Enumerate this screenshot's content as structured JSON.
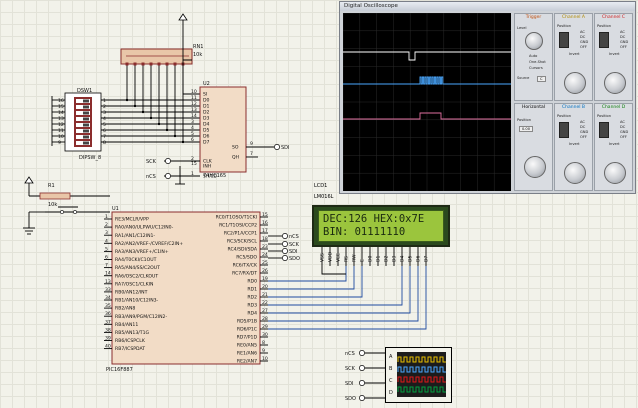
{
  "schematic": {
    "resistor_network": {
      "ref": "RN1",
      "value": "10k"
    },
    "dip_switch": {
      "ref": "DSW1",
      "part": "DIPSW_8",
      "left_pins": [
        "16",
        "15",
        "14",
        "13",
        "12",
        "11",
        "10",
        "9"
      ],
      "right_pins": [
        "1",
        "2",
        "3",
        "4",
        "5",
        "6",
        "7",
        "8"
      ]
    },
    "shift_register": {
      "ref": "U2",
      "part": "74HC165",
      "pins": [
        "SI",
        "D0",
        "D1",
        "D2",
        "D3",
        "D4",
        "D5",
        "D6",
        "D7",
        "CLK",
        "INH",
        "SH/LD"
      ],
      "out_pins": [
        "SO",
        "QH"
      ],
      "pin_numbers": [
        "10",
        "11",
        "12",
        "13",
        "14",
        "3",
        "4",
        "5",
        "6",
        "2",
        "15",
        "1",
        "9",
        "7"
      ]
    },
    "nets_u2": [
      "SCK",
      "nCS",
      "SDI"
    ],
    "resistor1": {
      "ref": "R1",
      "value": "10k"
    },
    "mcu": {
      "ref": "U1",
      "part": "PIC16F887",
      "left_pins": [
        "RE3/MCLR/VPP",
        "RA0/AN0/ULPWU/C12IN0-",
        "RA1/AN1/C12IN1-",
        "RA2/AN2/VREF-/CVREF/C2IN+",
        "RA3/AN3/VREF+/C1IN+",
        "RA4/T0CKI/C1OUT",
        "RA5/AN4/SS/C2OUT",
        "RA6/OSC2/CLKOUT",
        "RA7/OSC1/CLKIN",
        "RB0/AN12/INT",
        "RB1/AN10/C12IN3-",
        "RB2/AN8",
        "RB3/AN9/PGM/C12IN2-",
        "RB4/AN11",
        "RB5/AN13/T1G",
        "RB6/ICSPCLK",
        "RB7/ICSPDAT"
      ],
      "left_numbers": [
        "1",
        "2",
        "3",
        "4",
        "5",
        "6",
        "7",
        "14",
        "13",
        "33",
        "34",
        "35",
        "36",
        "37",
        "38",
        "39",
        "40"
      ],
      "right_pins": [
        "RC0/T1OSO/T1CKI",
        "RC1/T1OSI/CCP2",
        "RC2/P1A/CCP1",
        "RC3/SCK/SCL",
        "RC4/SDI/SDA",
        "RC5/SDO",
        "RC6/TX/CK",
        "RC7/RX/DT",
        "RD0",
        "RD1",
        "RD2",
        "RD3",
        "RD4",
        "RD5/P1B",
        "RD6/P1C",
        "RD7/P1D",
        "RE0/AN5",
        "RE1/AN6",
        "RE2/AN7"
      ],
      "right_numbers": [
        "15",
        "16",
        "17",
        "18",
        "23",
        "24",
        "25",
        "26",
        "19",
        "20",
        "21",
        "22",
        "27",
        "28",
        "29",
        "30",
        "8",
        "9",
        "10"
      ]
    },
    "mcu_nets": [
      "nCS",
      "SCK",
      "SDI",
      "SDO"
    ],
    "lcd": {
      "ref": "LCD1",
      "part": "LM016L",
      "line1": "DEC:126 HEX:0x7E",
      "line2": "BIN: 01111110",
      "pins": [
        "VSS",
        "VDD",
        "VEE",
        "RS",
        "RW",
        "E",
        "D0",
        "D1",
        "D2",
        "D3",
        "D4",
        "D5",
        "D6",
        "D7"
      ]
    },
    "logic_nets": [
      "nCS",
      "SCK",
      "SDI",
      "SDO"
    ],
    "logic_channels": [
      "A",
      "B",
      "C",
      "D"
    ]
  },
  "oscilloscope": {
    "title": "Digital Oscilloscope",
    "channels": [
      {
        "name": "Channel A",
        "color": "#e8c000",
        "position_label": "Position",
        "coupling": [
          "AC",
          "DC",
          "GND",
          "OFF"
        ],
        "invert": "Invert",
        "level": "Level"
      },
      {
        "name": "Channel B",
        "color": "#0090e0",
        "position_label": "Position",
        "coupling": [
          "AC",
          "DC",
          "GND",
          "OFF"
        ],
        "invert": "Invert"
      },
      {
        "name": "Channel C",
        "color": "#e02020",
        "position_label": "Position",
        "coupling": [
          "AC",
          "DC",
          "GND",
          "OFF"
        ],
        "invert": "Invert"
      },
      {
        "name": "Channel D",
        "color": "#20a020",
        "position_label": "Position",
        "coupling": [
          "AC",
          "DC",
          "GND",
          "OFF"
        ],
        "invert": "Invert"
      }
    ],
    "trigger": {
      "title": "Trigger",
      "items": [
        "Level",
        "Auto",
        "One-Shot",
        "Cursors",
        "Source"
      ],
      "source_value": "C"
    },
    "horizontal": {
      "title": "Horizontal",
      "position_label": "Position",
      "value": "0.00"
    },
    "colors": {
      "ch_a": "#e8c000",
      "ch_b": "#4aa8ff",
      "ch_c": "#e01818",
      "ch_d": "#00a040"
    }
  }
}
